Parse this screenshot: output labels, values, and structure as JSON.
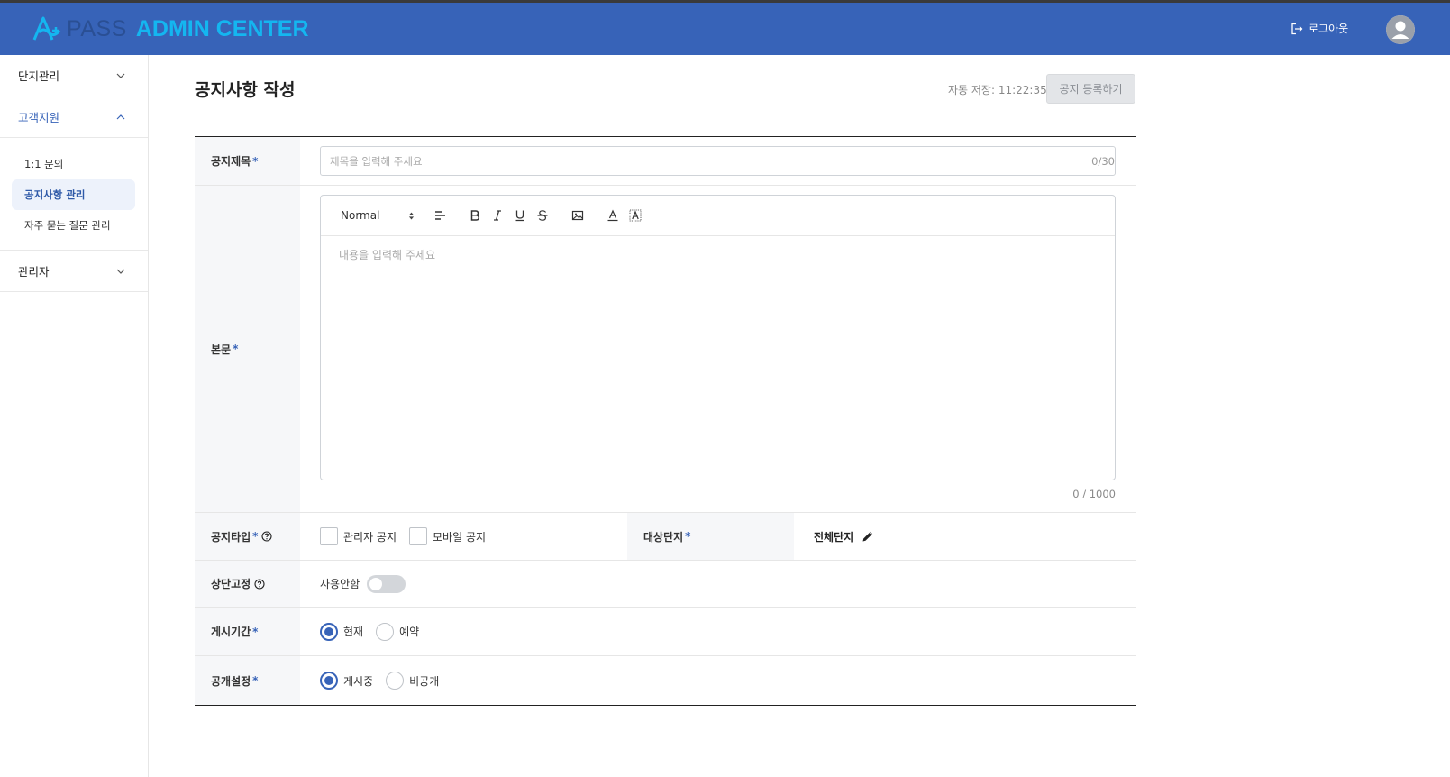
{
  "header": {
    "logo_pass": "PASS",
    "logo_admin": "ADMIN CENTER",
    "logout_label": "로그아웃",
    "brand_color": "#3763b8"
  },
  "sidebar": {
    "groups": [
      {
        "label": "단지관리",
        "expanded": false
      },
      {
        "label": "고객지원",
        "expanded": true,
        "items": [
          {
            "label": "1:1 문의",
            "active": false
          },
          {
            "label": "공지사항 관리",
            "active": true
          },
          {
            "label": "자주 묻는 질문 관리",
            "active": false
          }
        ]
      },
      {
        "label": "관리자",
        "expanded": false
      }
    ]
  },
  "page": {
    "title": "공지사항 작성",
    "autosave": "자동 저장: 11:22:35",
    "submit_label": "공지 등록하기"
  },
  "form": {
    "title_label": "공지제목",
    "title_placeholder": "제목을 입력해 주세요",
    "title_counter": "0/30",
    "body_label": "본문",
    "editor_format": "Normal",
    "body_placeholder": "내용을 입력해 주세요",
    "body_counter": "0 / 1000",
    "type_label": "공지타입",
    "type_options": [
      "관리자 공지",
      "모바일 공지"
    ],
    "target_label": "대상단지",
    "target_value": "전체단지",
    "pin_label": "상단고정",
    "pin_state": "사용안함",
    "period_label": "게시기간",
    "period_options": [
      "현재",
      "예약"
    ],
    "visibility_label": "공개설정",
    "visibility_options": [
      "게시중",
      "비공개"
    ]
  },
  "required_mark": "*"
}
